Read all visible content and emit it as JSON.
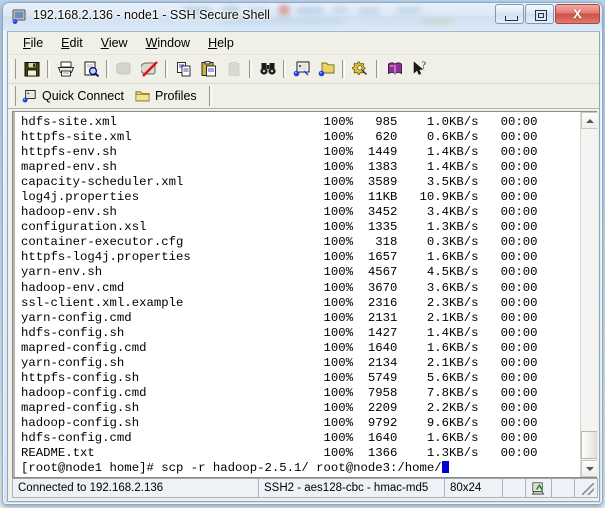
{
  "window": {
    "title": "192.168.2.136 - node1 - SSH Secure Shell",
    "icon": "ssh-app-icon",
    "minimize_label": "Minimize",
    "maximize_label": "Maximize",
    "close_label": "X"
  },
  "menubar": {
    "items": [
      {
        "label": "File",
        "accel": "F"
      },
      {
        "label": "Edit",
        "accel": "E"
      },
      {
        "label": "View",
        "accel": "V"
      },
      {
        "label": "Window",
        "accel": "W"
      },
      {
        "label": "Help",
        "accel": "H"
      }
    ]
  },
  "toolbar": {
    "buttons": [
      {
        "name": "save-icon",
        "tooltip": "Save",
        "enabled": true
      },
      {
        "name": "print-icon",
        "tooltip": "Print",
        "enabled": true
      },
      {
        "name": "print-preview-icon",
        "tooltip": "Print Preview",
        "enabled": true
      },
      {
        "name": "connect-icon",
        "tooltip": "Connect",
        "enabled": false
      },
      {
        "name": "disconnect-icon",
        "tooltip": "Disconnect",
        "enabled": true
      },
      {
        "name": "copy-icon",
        "tooltip": "Copy",
        "enabled": true
      },
      {
        "name": "paste-icon",
        "tooltip": "Paste",
        "enabled": true
      },
      {
        "name": "clipboard-icon",
        "tooltip": "Copy and Paste",
        "enabled": false
      },
      {
        "name": "find-icon",
        "tooltip": "Find",
        "enabled": true
      },
      {
        "name": "new-terminal-icon",
        "tooltip": "New Terminal Window",
        "enabled": true
      },
      {
        "name": "new-file-transfer-icon",
        "tooltip": "New File Transfer Window",
        "enabled": true
      },
      {
        "name": "settings-icon",
        "tooltip": "Settings",
        "enabled": true
      },
      {
        "name": "help-book-icon",
        "tooltip": "Help",
        "enabled": true
      },
      {
        "name": "context-help-icon",
        "tooltip": "Context Help",
        "enabled": true
      }
    ]
  },
  "quickbar": {
    "quick_connect": "Quick Connect",
    "quick_connect_icon": "quick-connect-icon",
    "profiles": "Profiles",
    "profiles_icon": "profiles-folder-icon"
  },
  "terminal": {
    "columns": 80,
    "rows": 24,
    "transfers": [
      {
        "file": "hdfs-site.xml",
        "percent": "100%",
        "size": "985",
        "rate": "1.0KB/s",
        "eta": "00:00"
      },
      {
        "file": "httpfs-site.xml",
        "percent": "100%",
        "size": "620",
        "rate": "0.6KB/s",
        "eta": "00:00"
      },
      {
        "file": "httpfs-env.sh",
        "percent": "100%",
        "size": "1449",
        "rate": "1.4KB/s",
        "eta": "00:00"
      },
      {
        "file": "mapred-env.sh",
        "percent": "100%",
        "size": "1383",
        "rate": "1.4KB/s",
        "eta": "00:00"
      },
      {
        "file": "capacity-scheduler.xml",
        "percent": "100%",
        "size": "3589",
        "rate": "3.5KB/s",
        "eta": "00:00"
      },
      {
        "file": "log4j.properties",
        "percent": "100%",
        "size": "11KB",
        "rate": "10.9KB/s",
        "eta": "00:00"
      },
      {
        "file": "hadoop-env.sh",
        "percent": "100%",
        "size": "3452",
        "rate": "3.4KB/s",
        "eta": "00:00"
      },
      {
        "file": "configuration.xsl",
        "percent": "100%",
        "size": "1335",
        "rate": "1.3KB/s",
        "eta": "00:00"
      },
      {
        "file": "container-executor.cfg",
        "percent": "100%",
        "size": "318",
        "rate": "0.3KB/s",
        "eta": "00:00"
      },
      {
        "file": "httpfs-log4j.properties",
        "percent": "100%",
        "size": "1657",
        "rate": "1.6KB/s",
        "eta": "00:00"
      },
      {
        "file": "yarn-env.sh",
        "percent": "100%",
        "size": "4567",
        "rate": "4.5KB/s",
        "eta": "00:00"
      },
      {
        "file": "hadoop-env.cmd",
        "percent": "100%",
        "size": "3670",
        "rate": "3.6KB/s",
        "eta": "00:00"
      },
      {
        "file": "ssl-client.xml.example",
        "percent": "100%",
        "size": "2316",
        "rate": "2.3KB/s",
        "eta": "00:00"
      },
      {
        "file": "yarn-config.cmd",
        "percent": "100%",
        "size": "2131",
        "rate": "2.1KB/s",
        "eta": "00:00"
      },
      {
        "file": "hdfs-config.sh",
        "percent": "100%",
        "size": "1427",
        "rate": "1.4KB/s",
        "eta": "00:00"
      },
      {
        "file": "mapred-config.cmd",
        "percent": "100%",
        "size": "1640",
        "rate": "1.6KB/s",
        "eta": "00:00"
      },
      {
        "file": "yarn-config.sh",
        "percent": "100%",
        "size": "2134",
        "rate": "2.1KB/s",
        "eta": "00:00"
      },
      {
        "file": "httpfs-config.sh",
        "percent": "100%",
        "size": "5749",
        "rate": "5.6KB/s",
        "eta": "00:00"
      },
      {
        "file": "hadoop-config.cmd",
        "percent": "100%",
        "size": "7958",
        "rate": "7.8KB/s",
        "eta": "00:00"
      },
      {
        "file": "mapred-config.sh",
        "percent": "100%",
        "size": "2209",
        "rate": "2.2KB/s",
        "eta": "00:00"
      },
      {
        "file": "hadoop-config.sh",
        "percent": "100%",
        "size": "9792",
        "rate": "9.6KB/s",
        "eta": "00:00"
      },
      {
        "file": "hdfs-config.cmd",
        "percent": "100%",
        "size": "1640",
        "rate": "1.6KB/s",
        "eta": "00:00"
      },
      {
        "file": "README.txt",
        "percent": "100%",
        "size": "1366",
        "rate": "1.3KB/s",
        "eta": "00:00"
      }
    ],
    "prompt": "[root@node1 home]#",
    "command": " scp -r hadoop-2.5.1/ root@node3:/home/",
    "cursor_color": "#0000d0"
  },
  "statusbar": {
    "connection": "Connected to 192.168.2.136",
    "cipher": "SSH2 - aes128-cbc - hmac-md5",
    "size": "80x24",
    "indicator_icon": "encryption-icon"
  }
}
